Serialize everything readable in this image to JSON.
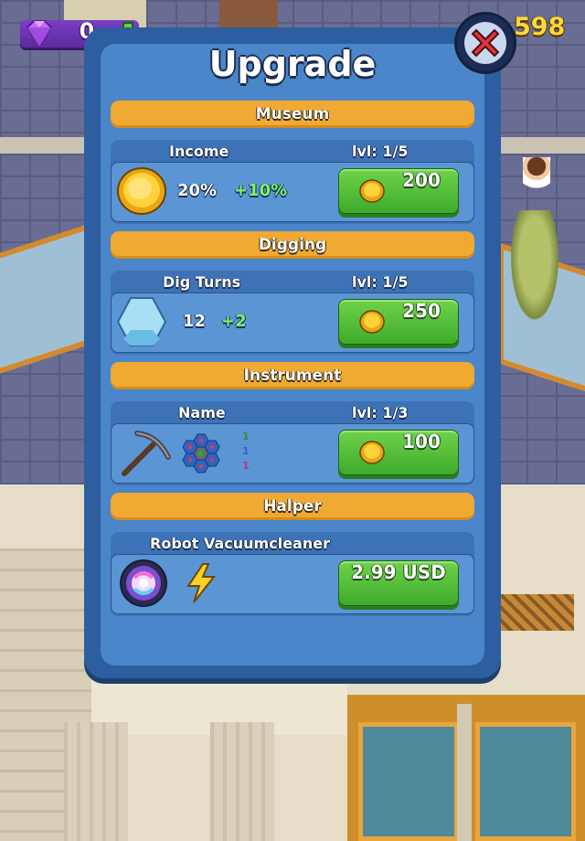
{
  "hud": {
    "gems": "0",
    "coins": "598",
    "gem_icon": "gem-icon",
    "plus_icon": "plus-icon"
  },
  "panel": {
    "title": "Upgrade",
    "close_icon": "close-icon"
  },
  "sections": [
    {
      "header": "Museum",
      "label": "Income",
      "level": "lvl: 1/5",
      "value": "20%",
      "bonus": "+10%",
      "price": "200",
      "icon": "gold-coin-icon"
    },
    {
      "header": "Digging",
      "label": "Dig Turns",
      "level": "lvl: 1/5",
      "value": "12",
      "bonus": "+2",
      "price": "250",
      "icon": "hexagon-tile-icon"
    },
    {
      "header": "Instrument",
      "label": "Name",
      "level": "lvl: 1/3",
      "nums": [
        "1",
        "1",
        "1"
      ],
      "price": "100",
      "icon": "pickaxe-icon"
    },
    {
      "header": "Halper",
      "label": "Robot Vacuumcleaner",
      "price": "2.99 USD",
      "icon": "robot-vacuum-icon"
    }
  ],
  "colors": {
    "panel": "#2c5ea0",
    "header": "#f0a933",
    "buy_button": "#4dbe35",
    "bonus": "#7ef56a",
    "coins_text": "#ffd73a"
  }
}
